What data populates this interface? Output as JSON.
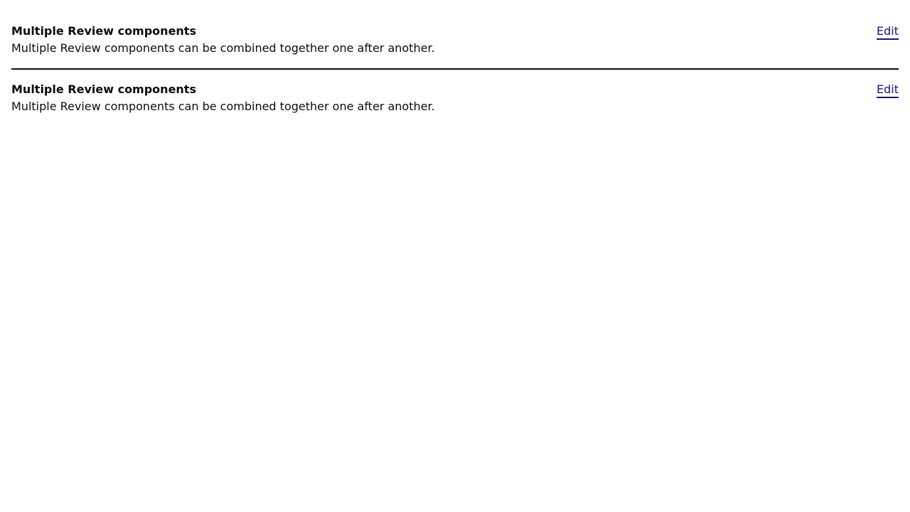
{
  "reviews": [
    {
      "title": "Multiple Review components",
      "description": "Multiple Review components can be combined together one after another.",
      "edit_label": "Edit"
    },
    {
      "title": "Multiple Review components",
      "description": "Multiple Review components can be combined together one after another.",
      "edit_label": "Edit"
    }
  ],
  "colors": {
    "text": "#0b0c0c",
    "link": "#1d0f83",
    "divider": "#0b0c0c",
    "background": "#ffffff"
  }
}
